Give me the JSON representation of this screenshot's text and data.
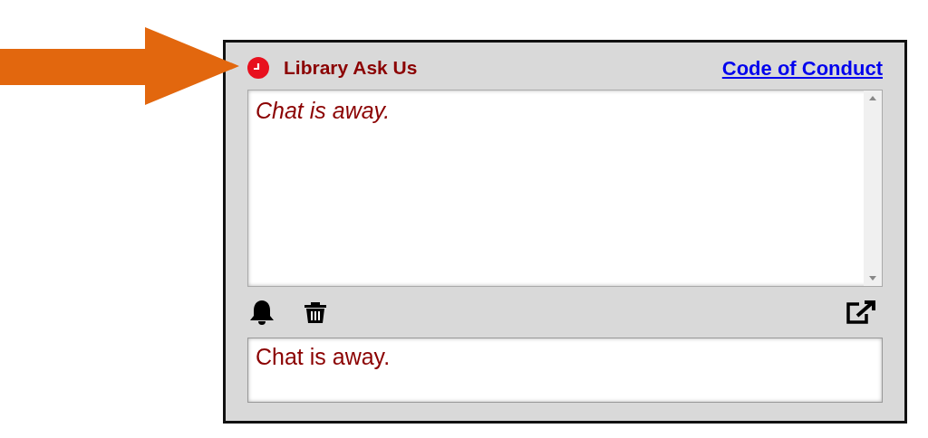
{
  "widget": {
    "title": "Library Ask Us",
    "away": true,
    "link": "Code of Conduct"
  },
  "transcript": {
    "messages": [
      "Chat is away."
    ]
  },
  "message_box": {
    "placeholder": "Chat is away."
  }
}
